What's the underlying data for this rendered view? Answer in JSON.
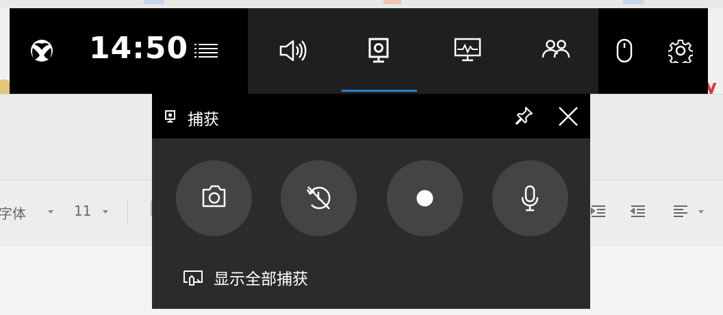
{
  "gamebar": {
    "time": "14:50",
    "widgets": [
      {
        "icon": "speaker-icon",
        "active": false
      },
      {
        "icon": "capture-widget-icon",
        "active": true
      },
      {
        "icon": "performance-icon",
        "active": false
      },
      {
        "icon": "social-icon",
        "active": false
      }
    ],
    "right_icons": [
      "mouse-icon",
      "gear-icon"
    ],
    "accent": "#2b7fd8"
  },
  "capture_panel": {
    "title": "捕获",
    "buttons": [
      "camera-icon",
      "record-last-icon",
      "record-dot-icon",
      "microphone-icon"
    ],
    "show_all_label": "显示全部捕获"
  },
  "background_app": {
    "font_label": "字体",
    "font_size": "11"
  }
}
